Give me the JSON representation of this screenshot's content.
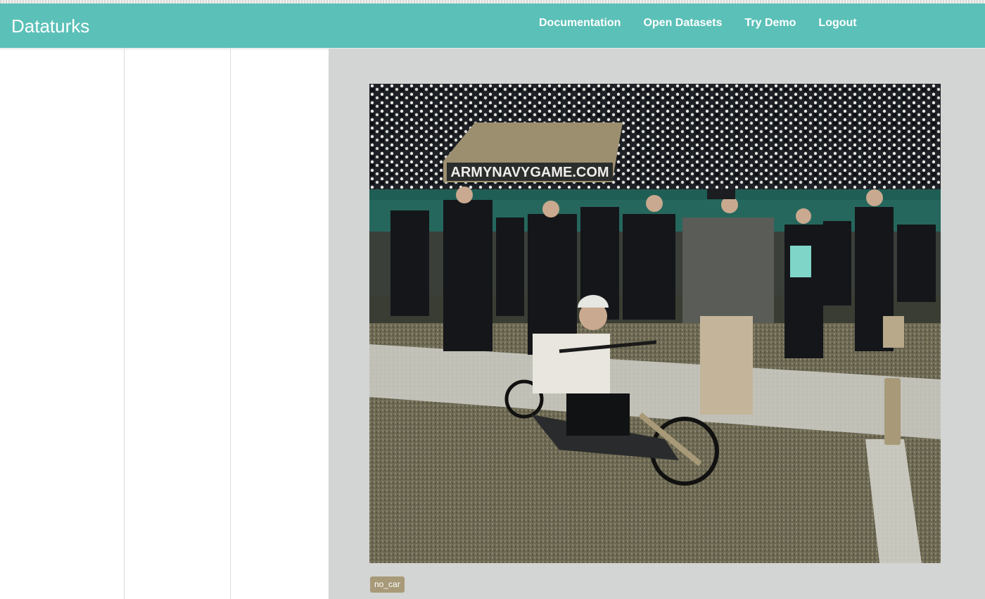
{
  "app": {
    "brand": "Dataturks"
  },
  "nav": {
    "items": [
      {
        "label": "Documentation"
      },
      {
        "label": "Open Datasets"
      },
      {
        "label": "Try Demo"
      },
      {
        "label": "Logout"
      }
    ]
  },
  "image": {
    "banner_text": "ARMYNAVYGAME.COM",
    "label": "no_car"
  },
  "colors": {
    "navbar": "#5bc0b8",
    "panel": "#d3d5d4",
    "tag": "#a89a78"
  }
}
